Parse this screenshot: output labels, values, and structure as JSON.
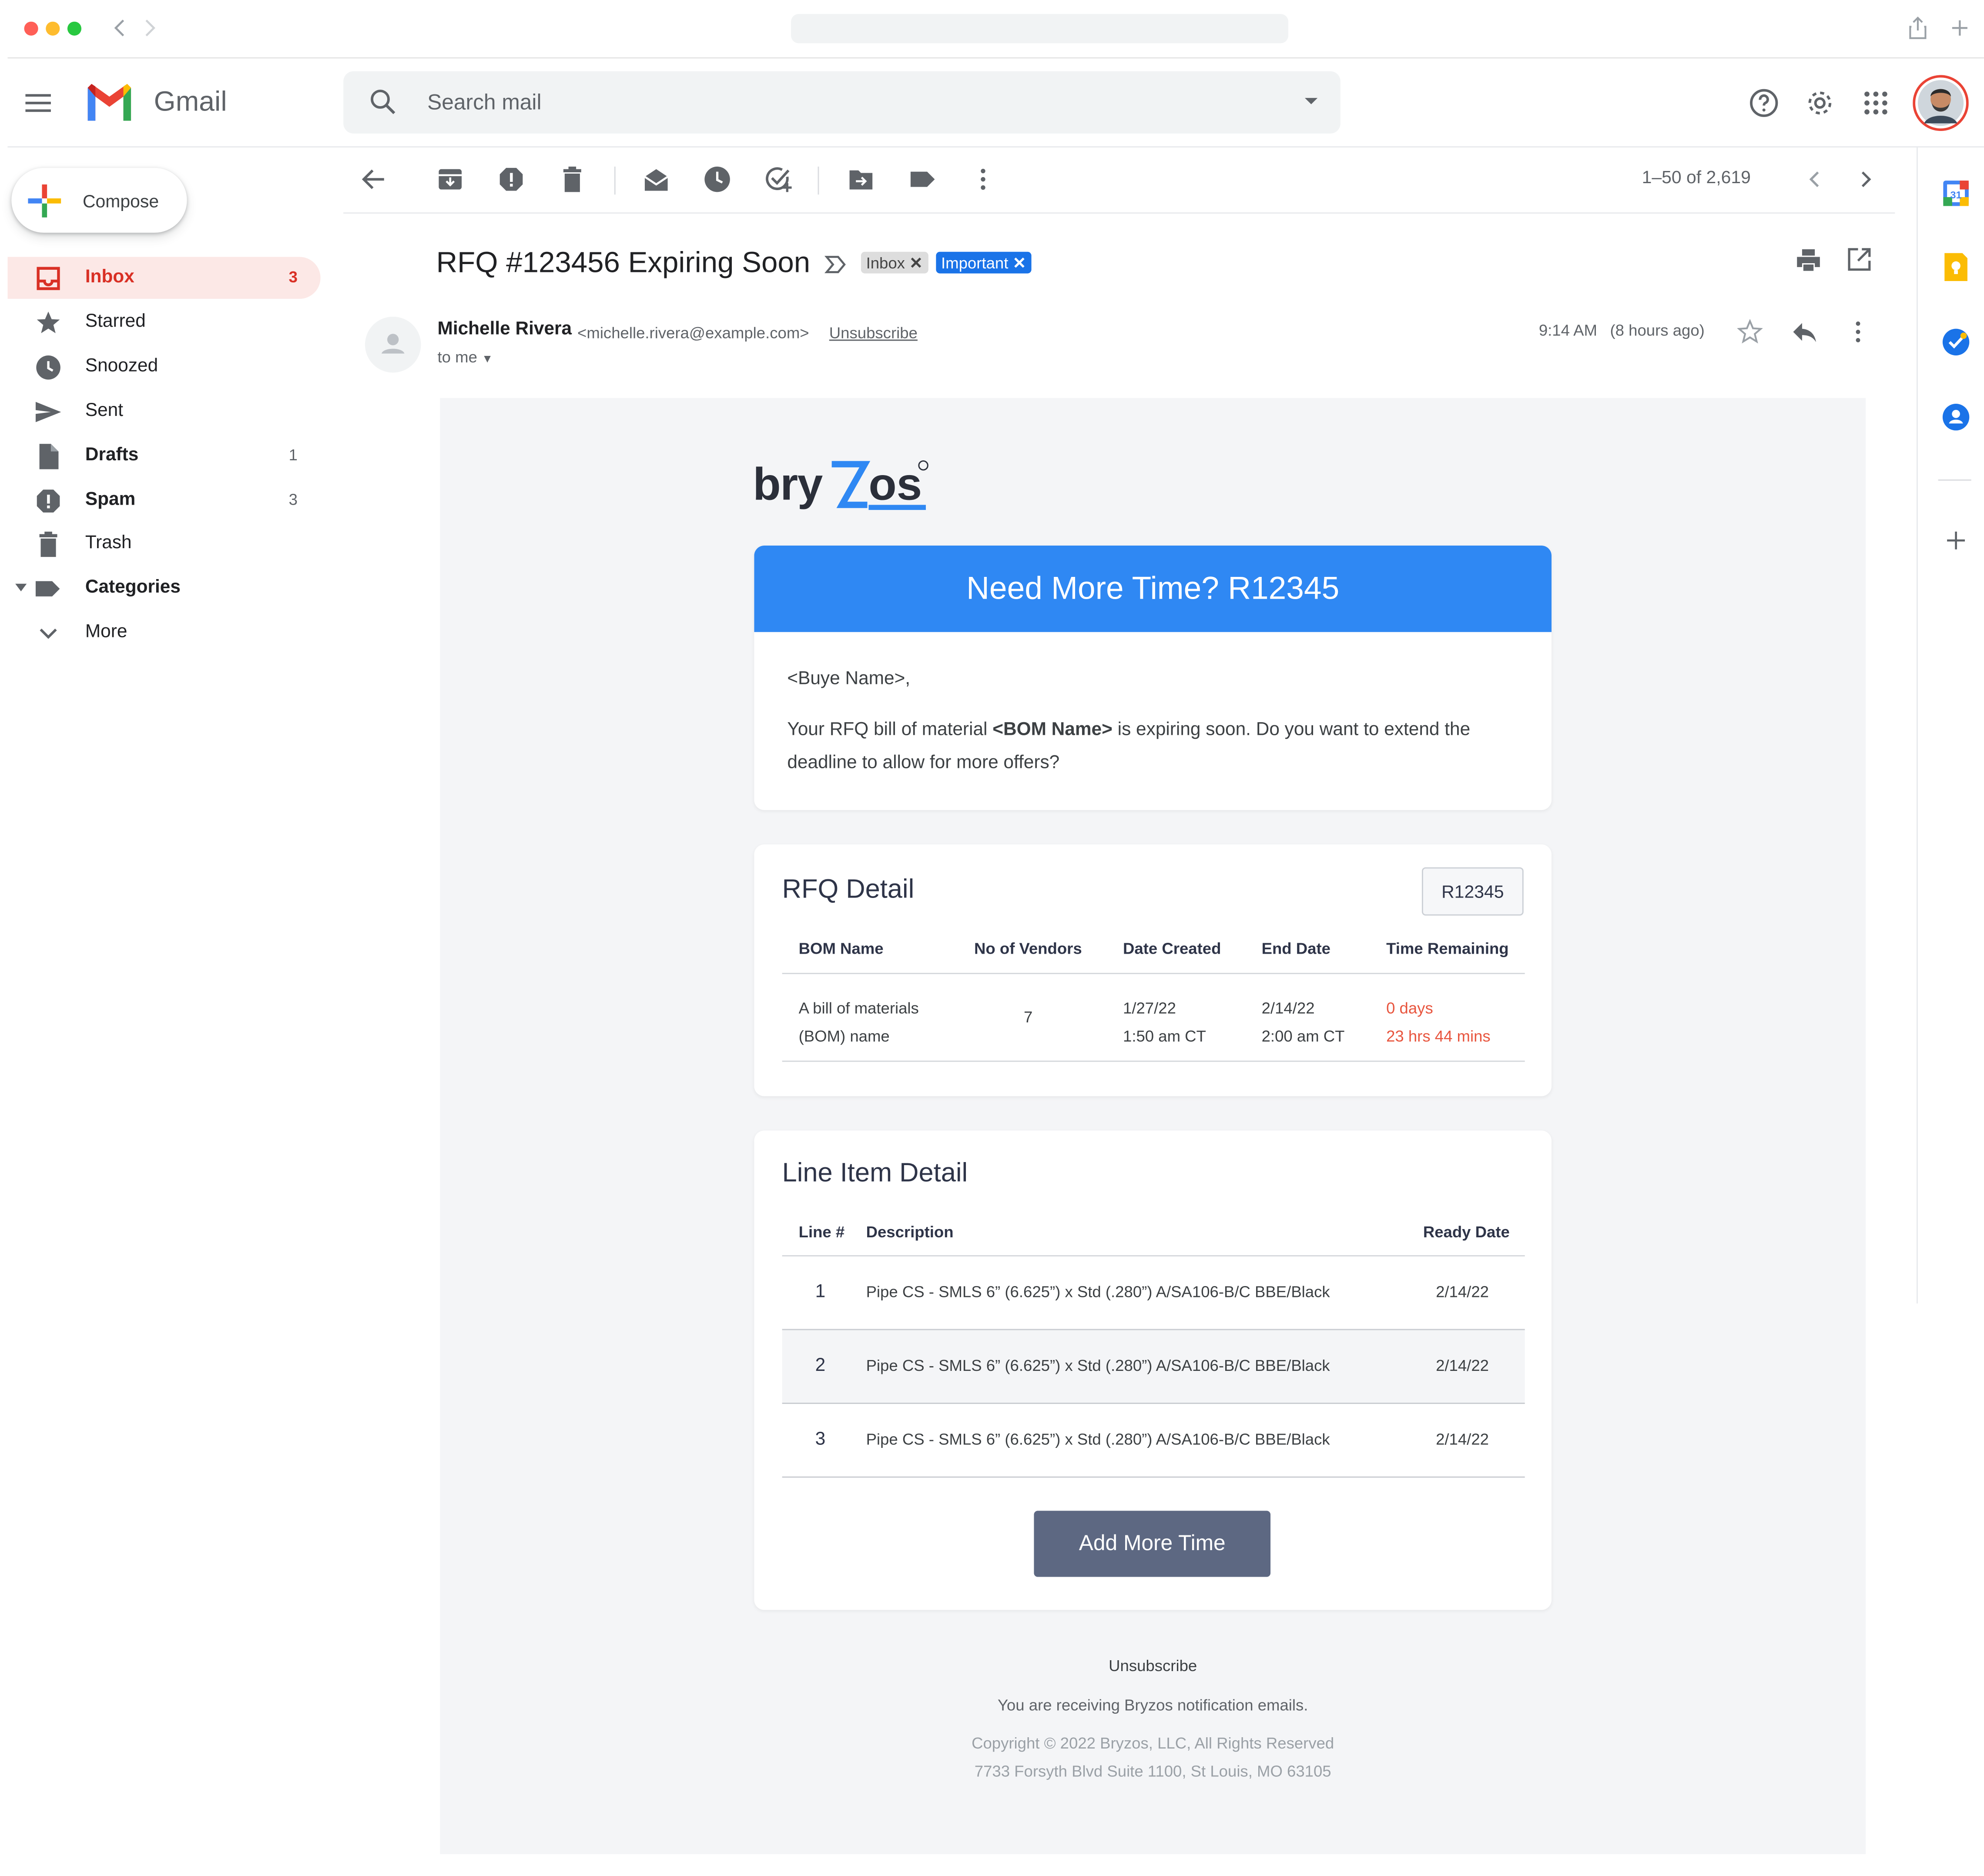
{
  "app": {
    "name": "Gmail"
  },
  "search": {
    "placeholder": "Search mail"
  },
  "sidebar": {
    "compose_label": "Compose",
    "items": [
      {
        "label": "Inbox",
        "count": "3"
      },
      {
        "label": "Starred",
        "count": ""
      },
      {
        "label": "Snoozed",
        "count": ""
      },
      {
        "label": "Sent",
        "count": ""
      },
      {
        "label": "Drafts",
        "count": "1"
      },
      {
        "label": "Spam",
        "count": "3"
      },
      {
        "label": "Trash",
        "count": ""
      },
      {
        "label": "Categories",
        "count": ""
      },
      {
        "label": "More",
        "count": ""
      }
    ]
  },
  "toolbar": {
    "pagination": "1–50 of 2,619"
  },
  "message": {
    "subject": "RFQ #123456 Expiring Soon",
    "labels": [
      "Inbox",
      "Important"
    ],
    "sender_name": "Michelle Rivera",
    "sender_email": "<michelle.rivera@example.com>",
    "unsubscribe_link": "Unsubscribe",
    "recipient": "to me",
    "time": "9:14 AM",
    "time_ago": "(8 hours ago)"
  },
  "email": {
    "logo_text": "bryzos",
    "banner_title": "Need More Time? R12345",
    "greeting": "<Buye Name>,",
    "body_pre": "Your RFQ bill of material ",
    "body_bold": "<BOM Name>",
    "body_post": " is expiring soon. Do you want to extend the deadline to allow for more offers?",
    "rfq": {
      "title": "RFQ Detail",
      "badge": "R12345",
      "headers": [
        "BOM Name",
        "No of Vendors",
        "Date Created",
        "End Date",
        "Time Remaining"
      ],
      "row": {
        "bom_line1": "A bill of materials",
        "bom_line2": "(BOM) name",
        "vendors": "7",
        "created_date": "1/27/22",
        "created_time": "1:50 am CT",
        "end_date": "2/14/22",
        "end_time": "2:00 am CT",
        "remaining_days": "0 days",
        "remaining_time": "23 hrs 44 mins"
      }
    },
    "line_items": {
      "title": "Line Item Detail",
      "headers": [
        "Line #",
        "Description",
        "Ready Date"
      ],
      "rows": [
        {
          "line": "1",
          "description": "Pipe CS - SMLS 6” (6.625”) x Std (.280”) A/SA106-B/C BBE/Black",
          "ready": "2/14/22"
        },
        {
          "line": "2",
          "description": "Pipe CS - SMLS 6” (6.625”) x Std (.280”) A/SA106-B/C BBE/Black",
          "ready": "2/14/22"
        },
        {
          "line": "3",
          "description": "Pipe CS - SMLS 6” (6.625”) x Std (.280”) A/SA106-B/C BBE/Black",
          "ready": "2/14/22"
        }
      ]
    },
    "cta_label": "Add More Time",
    "footer": {
      "unsubscribe": "Unsubscribe",
      "notice": "You are receiving Bryzos notification emails.",
      "copyright": "Copyright © 2022 Bryzos, LLC, All Rights Reserved",
      "address": "7733 Forsyth Blvd Suite 1100, St Louis, MO 63105"
    }
  },
  "colors": {
    "brand_blue": "#2f88f3",
    "cta": "#5d6882",
    "alert_red": "#e8553e",
    "inbox_red": "#d93025",
    "important_blue": "#1a73e8"
  }
}
